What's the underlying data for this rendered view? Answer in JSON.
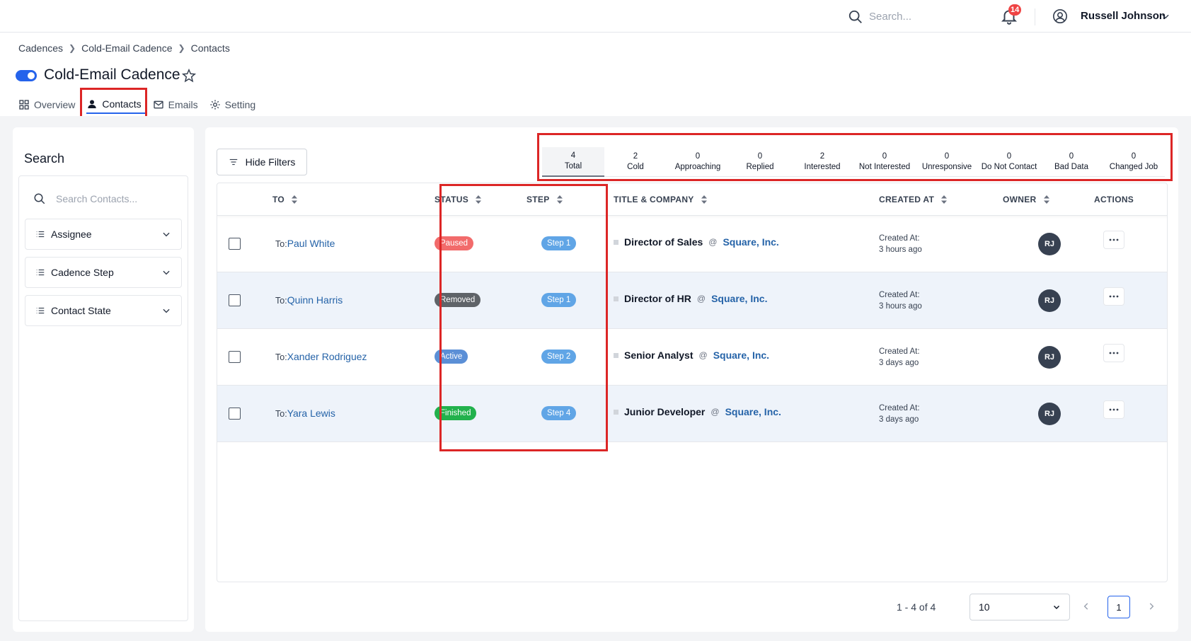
{
  "header": {
    "search_placeholder": "Search...",
    "notification_count": "14",
    "user_name": "Russell Johnson"
  },
  "breadcrumb": [
    "Cadences",
    "Cold-Email Cadence",
    "Contacts"
  ],
  "page": {
    "title": "Cold-Email Cadence",
    "tabs": [
      "Overview",
      "Contacts",
      "Emails",
      "Setting"
    ],
    "active_tab": "Contacts"
  },
  "sidebar": {
    "title": "Search",
    "search_placeholder": "Search Contacts...",
    "filters": [
      "Assignee",
      "Cadence Step",
      "Contact State"
    ]
  },
  "toolbar": {
    "hide_filters": "Hide Filters"
  },
  "stats": [
    {
      "count": "4",
      "label": "Total"
    },
    {
      "count": "2",
      "label": "Cold"
    },
    {
      "count": "0",
      "label": "Approaching"
    },
    {
      "count": "0",
      "label": "Replied"
    },
    {
      "count": "2",
      "label": "Interested"
    },
    {
      "count": "0",
      "label": "Not Interested"
    },
    {
      "count": "0",
      "label": "Unresponsive"
    },
    {
      "count": "0",
      "label": "Do Not Contact"
    },
    {
      "count": "0",
      "label": "Bad Data"
    },
    {
      "count": "0",
      "label": "Changed Job"
    }
  ],
  "table": {
    "columns": [
      "TO",
      "STATUS",
      "STEP",
      "TITLE & COMPANY",
      "CREATED AT",
      "OWNER",
      "ACTIONS"
    ],
    "rows": [
      {
        "to_prefix": "To:",
        "to": "Paul White",
        "status": "Paused",
        "step": "Step 1",
        "title": "Director of Sales",
        "at": "@",
        "company": "Square, Inc.",
        "created_label": "Created At:",
        "created": "3 hours ago",
        "owner": "RJ"
      },
      {
        "to_prefix": "To:",
        "to": "Quinn Harris",
        "status": "Removed",
        "step": "Step 1",
        "title": "Director of HR",
        "at": "@",
        "company": "Square, Inc.",
        "created_label": "Created At:",
        "created": "3 hours ago",
        "owner": "RJ"
      },
      {
        "to_prefix": "To:",
        "to": "Xander Rodriguez",
        "status": "Active",
        "step": "Step 2",
        "title": "Senior Analyst",
        "at": "@",
        "company": "Square, Inc.",
        "created_label": "Created At:",
        "created": "3 days ago",
        "owner": "RJ"
      },
      {
        "to_prefix": "To:",
        "to": "Yara Lewis",
        "status": "Finished",
        "step": "Step 4",
        "title": "Junior Developer",
        "at": "@",
        "company": "Square, Inc.",
        "created_label": "Created At:",
        "created": "3 days ago",
        "owner": "RJ"
      }
    ]
  },
  "pagination": {
    "range": "1 - 4 of 4",
    "page_size": "10",
    "current_page": "1"
  },
  "colors": {
    "accent": "#2563eb",
    "highlight": "#dc2626",
    "status_paused": "#f26b6b",
    "status_removed": "#5f6368",
    "status_active": "#5b8fd6",
    "status_finished": "#22b14c",
    "step": "#60a5e6"
  },
  "icons": [
    "search-icon",
    "bell-icon",
    "user-circle-icon",
    "chevron-down-icon",
    "star-icon",
    "grid-icon",
    "person-icon",
    "mail-icon",
    "gear-icon",
    "list-icon",
    "sliders-icon",
    "sort-icon",
    "more-icon",
    "chevron-left-icon",
    "chevron-right-icon"
  ]
}
